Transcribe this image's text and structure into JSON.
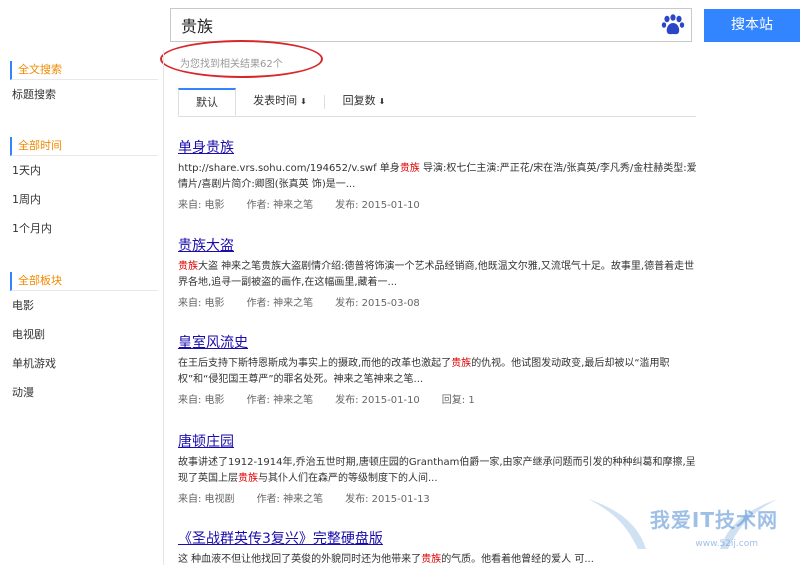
{
  "search": {
    "query": "贵族",
    "button_label": "搜本站",
    "result_count": "为您找到相关结果62个"
  },
  "sidebar": {
    "groups": [
      {
        "head": "全文搜索",
        "items": [
          "标题搜索"
        ]
      },
      {
        "head": "全部时间",
        "items": [
          "1天内",
          "1周内",
          "1个月内"
        ]
      },
      {
        "head": "全部板块",
        "items": [
          "电影",
          "电视剧",
          "单机游戏",
          "动漫"
        ]
      }
    ]
  },
  "tabs": [
    {
      "label": "默认",
      "arrow": ""
    },
    {
      "label": "发表时间",
      "arrow": "⬇"
    },
    {
      "label": "回复数",
      "arrow": "⬇"
    }
  ],
  "results": [
    {
      "title": "单身贵族",
      "snippet_before": "http://share.vrs.sohu.com/194652/v.swf 单身",
      "snippet_hl": "贵族",
      "snippet_after": " 导演:权七仁主演:严正花/宋在浩/张真英/李凡秀/金柱赫类型:爱情片/喜剧片简介:卿图(张真英 饰)是一...",
      "source": "来自: 电影",
      "author": "作者: 神来之笔",
      "date": "发布: 2015-01-10",
      "replies": ""
    },
    {
      "title": "贵族大盗",
      "snippet_before": "",
      "snippet_hl": "贵族",
      "snippet_after": "大盗 神来之笔贵族大盗剧情介绍:德普将饰演一个艺术品经销商,他既温文尔雅,又流氓气十足。故事里,德普着走世界各地,追寻一副被盗的画作,在这幅画里,藏着一...",
      "source": "来自: 电影",
      "author": "作者: 神来之笔",
      "date": "发布: 2015-03-08",
      "replies": ""
    },
    {
      "title": "皇室风流史",
      "snippet_before": "在王后支持下斯特恩斯成为事实上的摄政,而他的改革也激起了",
      "snippet_hl": "贵族",
      "snippet_after": "的仇视。他试图发动政变,最后却被以“滥用职权”和“侵犯国王尊严”的罪名处死。神来之笔神来之笔...",
      "source": "来自: 电影",
      "author": "作者: 神来之笔",
      "date": "发布: 2015-01-10",
      "replies": "回复: 1"
    },
    {
      "title": "唐顿庄园",
      "snippet_before": "故事讲述了1912-1914年,乔治五世时期,唐顿庄园的Grantham伯爵一家,由家产继承问题而引发的种种纠葛和摩擦,呈现了英国上层",
      "snippet_hl": "贵族",
      "snippet_after": "与其仆人们在森严的等级制度下的人间...",
      "source": "来自: 电视剧",
      "author": "作者: 神来之笔",
      "date": "发布: 2015-01-13",
      "replies": ""
    },
    {
      "title": "《圣战群英传3复兴》完整硬盘版",
      "snippet_before": "这 种血液不但让他找回了英俊的外貌同时还为他带来了",
      "snippet_hl": "贵族",
      "snippet_after": "的气质。他看着他曾经的爱人 可...",
      "source": "",
      "author": "",
      "date": "",
      "replies": ""
    }
  ],
  "watermark": {
    "main": "我爱IT技术网",
    "sub": "www.52ij.com"
  },
  "colors": {
    "accent": "#3385ff",
    "highlight": "#d00000",
    "circle": "#d8272a",
    "sidebar_head": "#f08a00"
  }
}
